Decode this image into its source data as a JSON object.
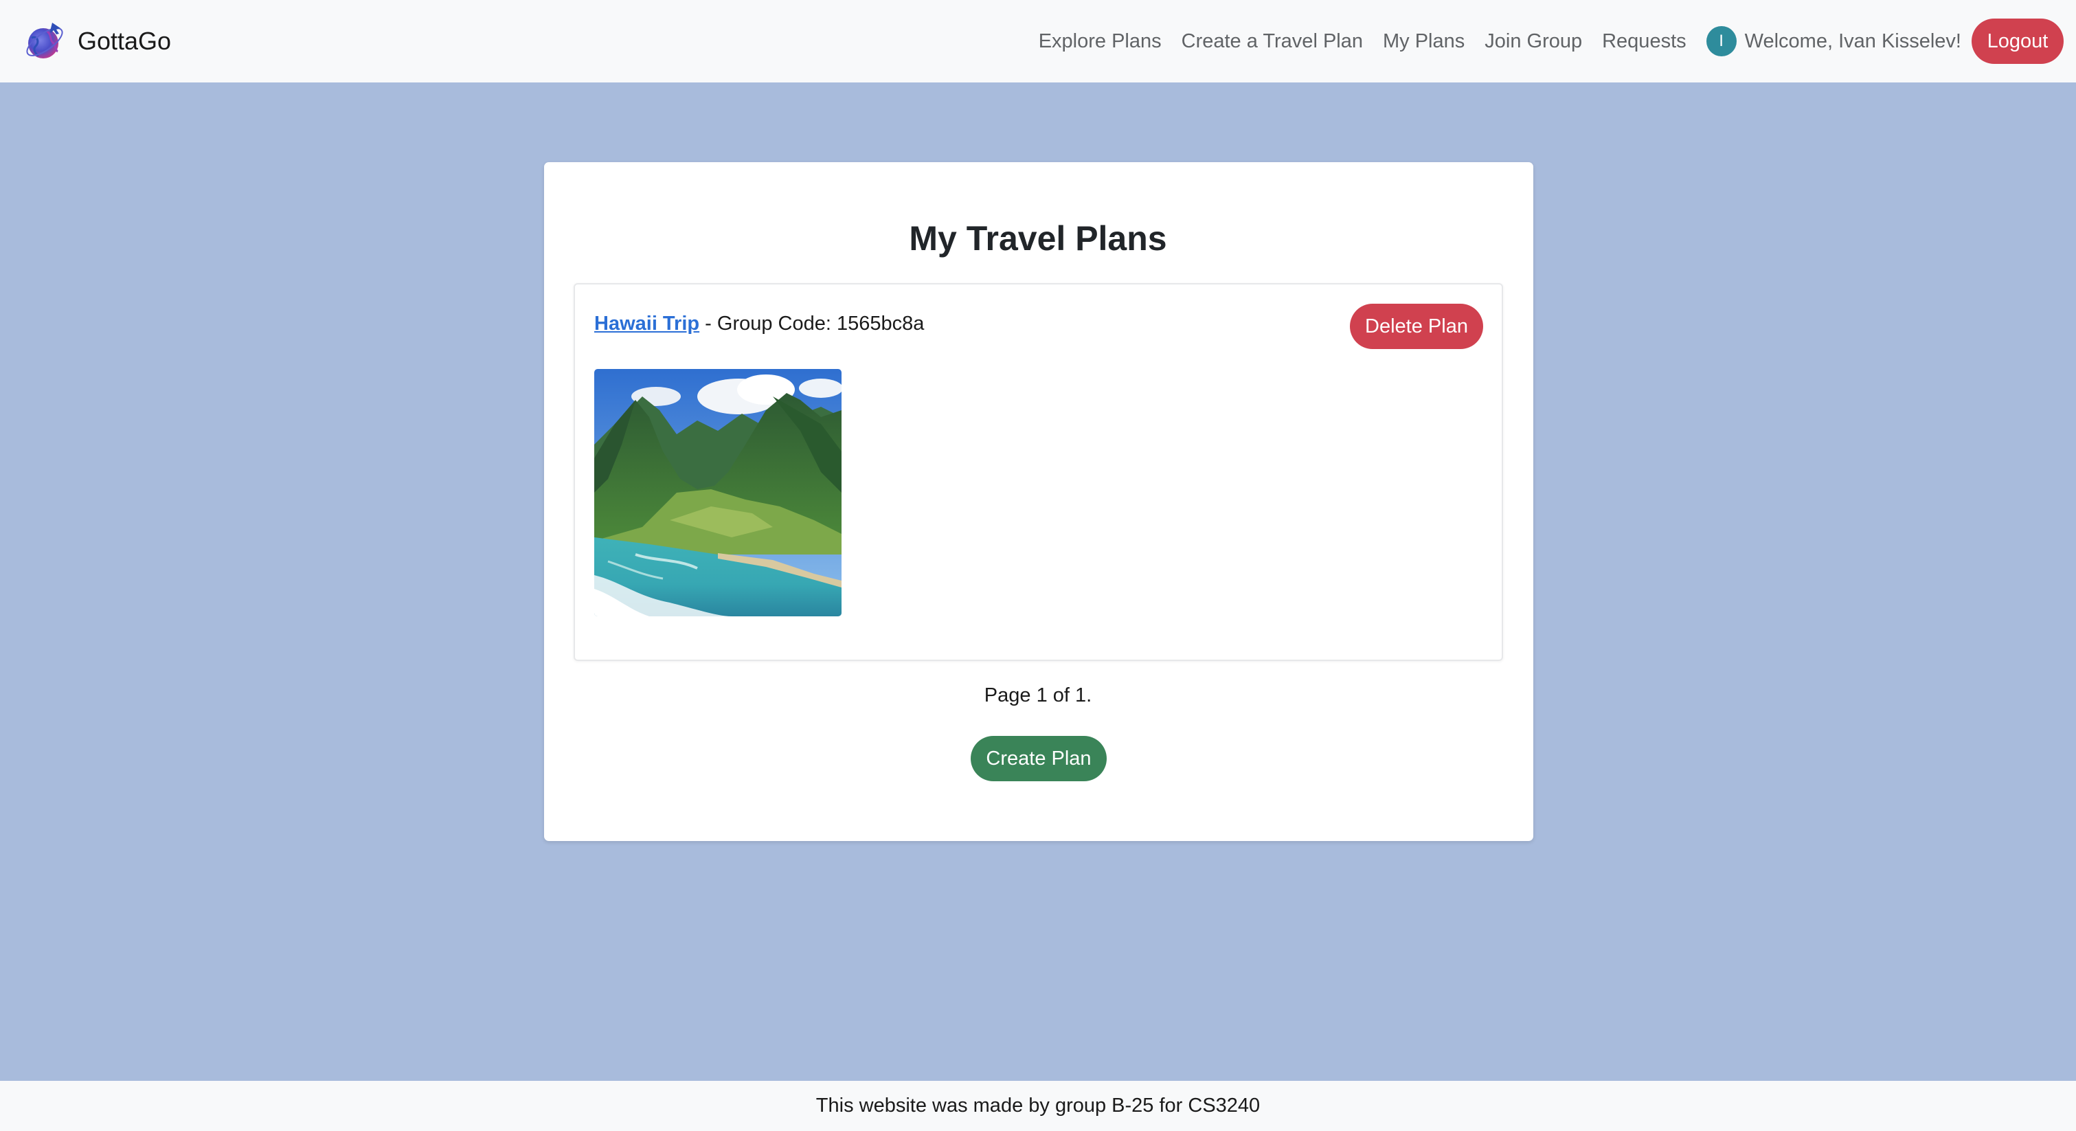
{
  "navbar": {
    "brand_name": "GottaGo",
    "links": [
      {
        "label": "Explore Plans"
      },
      {
        "label": "Create a Travel Plan"
      },
      {
        "label": "My Plans"
      },
      {
        "label": "Join Group"
      },
      {
        "label": "Requests"
      }
    ],
    "avatar_initial": "I",
    "welcome": "Welcome, Ivan Kisselev!",
    "logout_label": "Logout"
  },
  "main": {
    "title": "My Travel Plans",
    "plans": [
      {
        "name": "Hawaii Trip",
        "group_code_text": " - Group Code: 1565bc8a",
        "delete_label": "Delete Plan"
      }
    ],
    "pagination": "Page 1 of 1.",
    "create_label": "Create Plan"
  },
  "footer": {
    "text": "This website was made by group B-25 for CS3240"
  },
  "colors": {
    "page_background": "#a8bbdc",
    "navbar_background": "#f8f9fa",
    "danger": "#d0414f",
    "success": "#3a8458",
    "link": "#2b6fd6",
    "avatar": "#2e8c9c"
  }
}
